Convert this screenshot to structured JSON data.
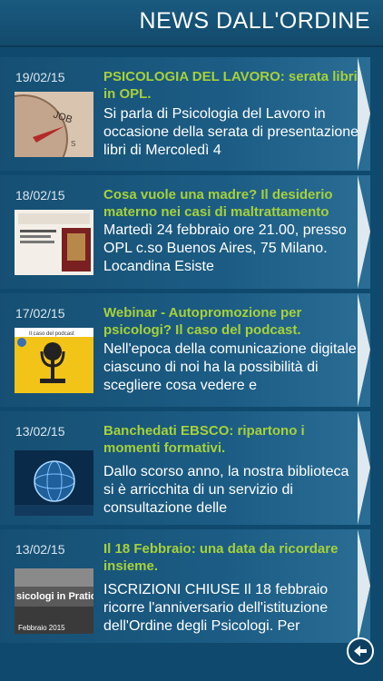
{
  "header": {
    "title": "NEWS DALL'ORDINE"
  },
  "news": [
    {
      "date": "19/02/15",
      "title": "PSICOLOGIA DEL LAVORO: serata libri in OPL.",
      "body": "Si parla di Psicologia del Lavoro in occasione della serata di presentazione libri di Mercoledì 4",
      "thumb": "compass-job-thumbnail"
    },
    {
      "date": "18/02/15",
      "title": "Cosa vuole una madre? Il desiderio materno nei casi di maltrattamento",
      "body": "Martedì 24 febbraio ore 21.00, presso OPL c.so Buenos Aires, 75 Milano. Locandina Esiste",
      "thumb": "event-poster-thumbnail"
    },
    {
      "date": "17/02/15",
      "title": "Webinar - Autopromozione per psicologi? Il caso del podcast.",
      "body": "Nell'epoca della comunicazione digitale ciascuno di noi ha la possibilità di scegliere cosa vedere e",
      "thumb": "microphone-thumbnail",
      "thumb_text": "Il caso del podcast"
    },
    {
      "date": "13/02/15",
      "title": "Banchedati EBSCO: ripartono i momenti formativi.",
      "body": "Dallo scorso anno, la nostra biblioteca si è arricchita di un servizio di consultazione delle",
      "thumb": "digital-globe-thumbnail"
    },
    {
      "date": "13/02/15",
      "title": "Il 18 Febbraio: una data da ricordare insieme.",
      "body": "ISCRIZIONI CHIUSE Il 18 febbraio ricorre l'anniversario dell'istituzione dell'Ordine degli Psicologi. Per",
      "thumb": "psicologi-in-pratica-thumbnail",
      "thumb_text": "sicologi in Pratic",
      "thumb_date": "Febbraio 2015"
    }
  ],
  "footer": {
    "back_icon": "back-arrow-icon"
  },
  "colors": {
    "title_green": "#a6d13a",
    "header_bg": "#1a5a80"
  }
}
